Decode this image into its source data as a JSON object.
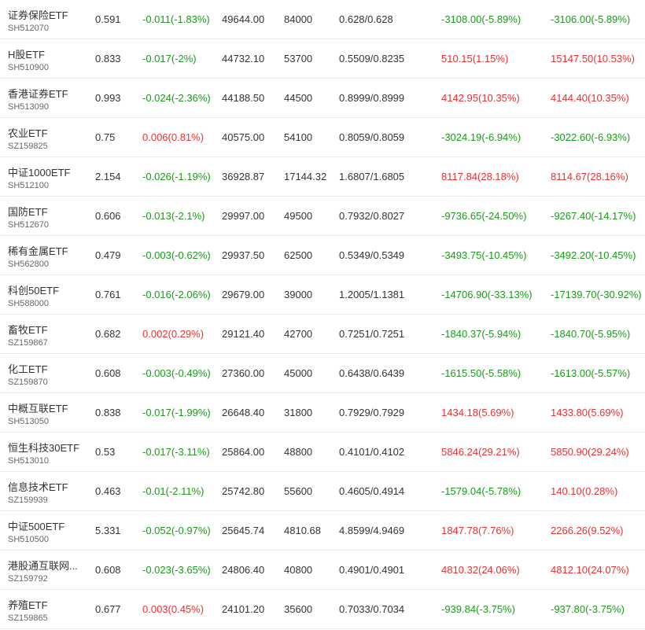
{
  "colors": {
    "up": "#e93030",
    "down": "#1a9a1a"
  },
  "rows": [
    {
      "name": "证券保险ETF",
      "code": "SH512070",
      "price": "0.591",
      "change": "-0.011(-1.83%)",
      "change_dir": "down",
      "amount": "49644.00",
      "share": "84000",
      "nav": "0.628/0.628",
      "flow1": "-3108.00(-5.89%)",
      "flow1_dir": "down",
      "flow2": "-3106.00(-5.89%)",
      "flow2_dir": "down"
    },
    {
      "name": "H股ETF",
      "code": "SH510900",
      "price": "0.833",
      "change": "-0.017(-2%)",
      "change_dir": "down",
      "amount": "44732.10",
      "share": "53700",
      "nav": "0.5509/0.8235",
      "flow1": "510.15(1.15%)",
      "flow1_dir": "up",
      "flow2": "15147.50(10.53%)",
      "flow2_dir": "up"
    },
    {
      "name": "香港证券ETF",
      "code": "SH513090",
      "price": "0.993",
      "change": "-0.024(-2.36%)",
      "change_dir": "down",
      "amount": "44188.50",
      "share": "44500",
      "nav": "0.8999/0.8999",
      "flow1": "4142.95(10.35%)",
      "flow1_dir": "up",
      "flow2": "4144.40(10.35%)",
      "flow2_dir": "up"
    },
    {
      "name": "农业ETF",
      "code": "SZ159825",
      "price": "0.75",
      "change": "0.006(0.81%)",
      "change_dir": "up",
      "amount": "40575.00",
      "share": "54100",
      "nav": "0.8059/0.8059",
      "flow1": "-3024.19(-6.94%)",
      "flow1_dir": "down",
      "flow2": "-3022.60(-6.93%)",
      "flow2_dir": "down"
    },
    {
      "name": "中证1000ETF",
      "code": "SH512100",
      "price": "2.154",
      "change": "-0.026(-1.19%)",
      "change_dir": "down",
      "amount": "36928.87",
      "share": "17144.32",
      "nav": "1.6807/1.6805",
      "flow1": "8117.84(28.18%)",
      "flow1_dir": "up",
      "flow2": "8114.67(28.16%)",
      "flow2_dir": "up"
    },
    {
      "name": "国防ETF",
      "code": "SH512670",
      "price": "0.606",
      "change": "-0.013(-2.1%)",
      "change_dir": "down",
      "amount": "29997.00",
      "share": "49500",
      "nav": "0.7932/0.8027",
      "flow1": "-9736.65(-24.50%)",
      "flow1_dir": "down",
      "flow2": "-9267.40(-14.17%)",
      "flow2_dir": "down"
    },
    {
      "name": "稀有金属ETF",
      "code": "SH562800",
      "price": "0.479",
      "change": "-0.003(-0.62%)",
      "change_dir": "down",
      "amount": "29937.50",
      "share": "62500",
      "nav": "0.5349/0.5349",
      "flow1": "-3493.75(-10.45%)",
      "flow1_dir": "down",
      "flow2": "-3492.20(-10.45%)",
      "flow2_dir": "down"
    },
    {
      "name": "科创50ETF",
      "code": "SH588000",
      "price": "0.761",
      "change": "-0.016(-2.06%)",
      "change_dir": "down",
      "amount": "29679.00",
      "share": "39000",
      "nav": "1.2005/1.1381",
      "flow1": "-14706.90(-33.13%)",
      "flow1_dir": "down",
      "flow2": "-17139.70(-30.92%)",
      "flow2_dir": "down"
    },
    {
      "name": "畜牧ETF",
      "code": "SZ159867",
      "price": "0.682",
      "change": "0.002(0.29%)",
      "change_dir": "up",
      "amount": "29121.40",
      "share": "42700",
      "nav": "0.7251/0.7251",
      "flow1": "-1840.37(-5.94%)",
      "flow1_dir": "down",
      "flow2": "-1840.70(-5.95%)",
      "flow2_dir": "down"
    },
    {
      "name": "化工ETF",
      "code": "SZ159870",
      "price": "0.608",
      "change": "-0.003(-0.49%)",
      "change_dir": "down",
      "amount": "27360.00",
      "share": "45000",
      "nav": "0.6438/0.6439",
      "flow1": "-1615.50(-5.58%)",
      "flow1_dir": "down",
      "flow2": "-1613.00(-5.57%)",
      "flow2_dir": "down"
    },
    {
      "name": "中概互联ETF",
      "code": "SH513050",
      "price": "0.838",
      "change": "-0.017(-1.99%)",
      "change_dir": "down",
      "amount": "26648.40",
      "share": "31800",
      "nav": "0.7929/0.7929",
      "flow1": "1434.18(5.69%)",
      "flow1_dir": "up",
      "flow2": "1433.80(5.69%)",
      "flow2_dir": "up"
    },
    {
      "name": "恒生科技30ETF",
      "code": "SH513010",
      "price": "0.53",
      "change": "-0.017(-3.11%)",
      "change_dir": "down",
      "amount": "25864.00",
      "share": "48800",
      "nav": "0.4101/0.4102",
      "flow1": "5846.24(29.21%)",
      "flow1_dir": "up",
      "flow2": "5850.90(29.24%)",
      "flow2_dir": "up"
    },
    {
      "name": "信息技术ETF",
      "code": "SZ159939",
      "price": "0.463",
      "change": "-0.01(-2.11%)",
      "change_dir": "down",
      "amount": "25742.80",
      "share": "55600",
      "nav": "0.4605/0.4914",
      "flow1": "-1579.04(-5.78%)",
      "flow1_dir": "down",
      "flow2": "140.10(0.28%)",
      "flow2_dir": "up"
    },
    {
      "name": "中证500ETF",
      "code": "SH510500",
      "price": "5.331",
      "change": "-0.052(-0.97%)",
      "change_dir": "down",
      "amount": "25645.74",
      "share": "4810.68",
      "nav": "4.8599/4.9469",
      "flow1": "1847.78(7.76%)",
      "flow1_dir": "up",
      "flow2": "2266.26(9.52%)",
      "flow2_dir": "up"
    },
    {
      "name": "港股通互联网...",
      "code": "SZ159792",
      "price": "0.608",
      "change": "-0.023(-3.65%)",
      "change_dir": "down",
      "amount": "24806.40",
      "share": "40800",
      "nav": "0.4901/0.4901",
      "flow1": "4810.32(24.06%)",
      "flow1_dir": "up",
      "flow2": "4812.10(24.07%)",
      "flow2_dir": "up"
    },
    {
      "name": "养殖ETF",
      "code": "SZ159865",
      "price": "0.677",
      "change": "0.003(0.45%)",
      "change_dir": "up",
      "amount": "24101.20",
      "share": "35600",
      "nav": "0.7033/0.7034",
      "flow1": "-939.84(-3.75%)",
      "flow1_dir": "down",
      "flow2": "-937.80(-3.75%)",
      "flow2_dir": "down"
    }
  ]
}
